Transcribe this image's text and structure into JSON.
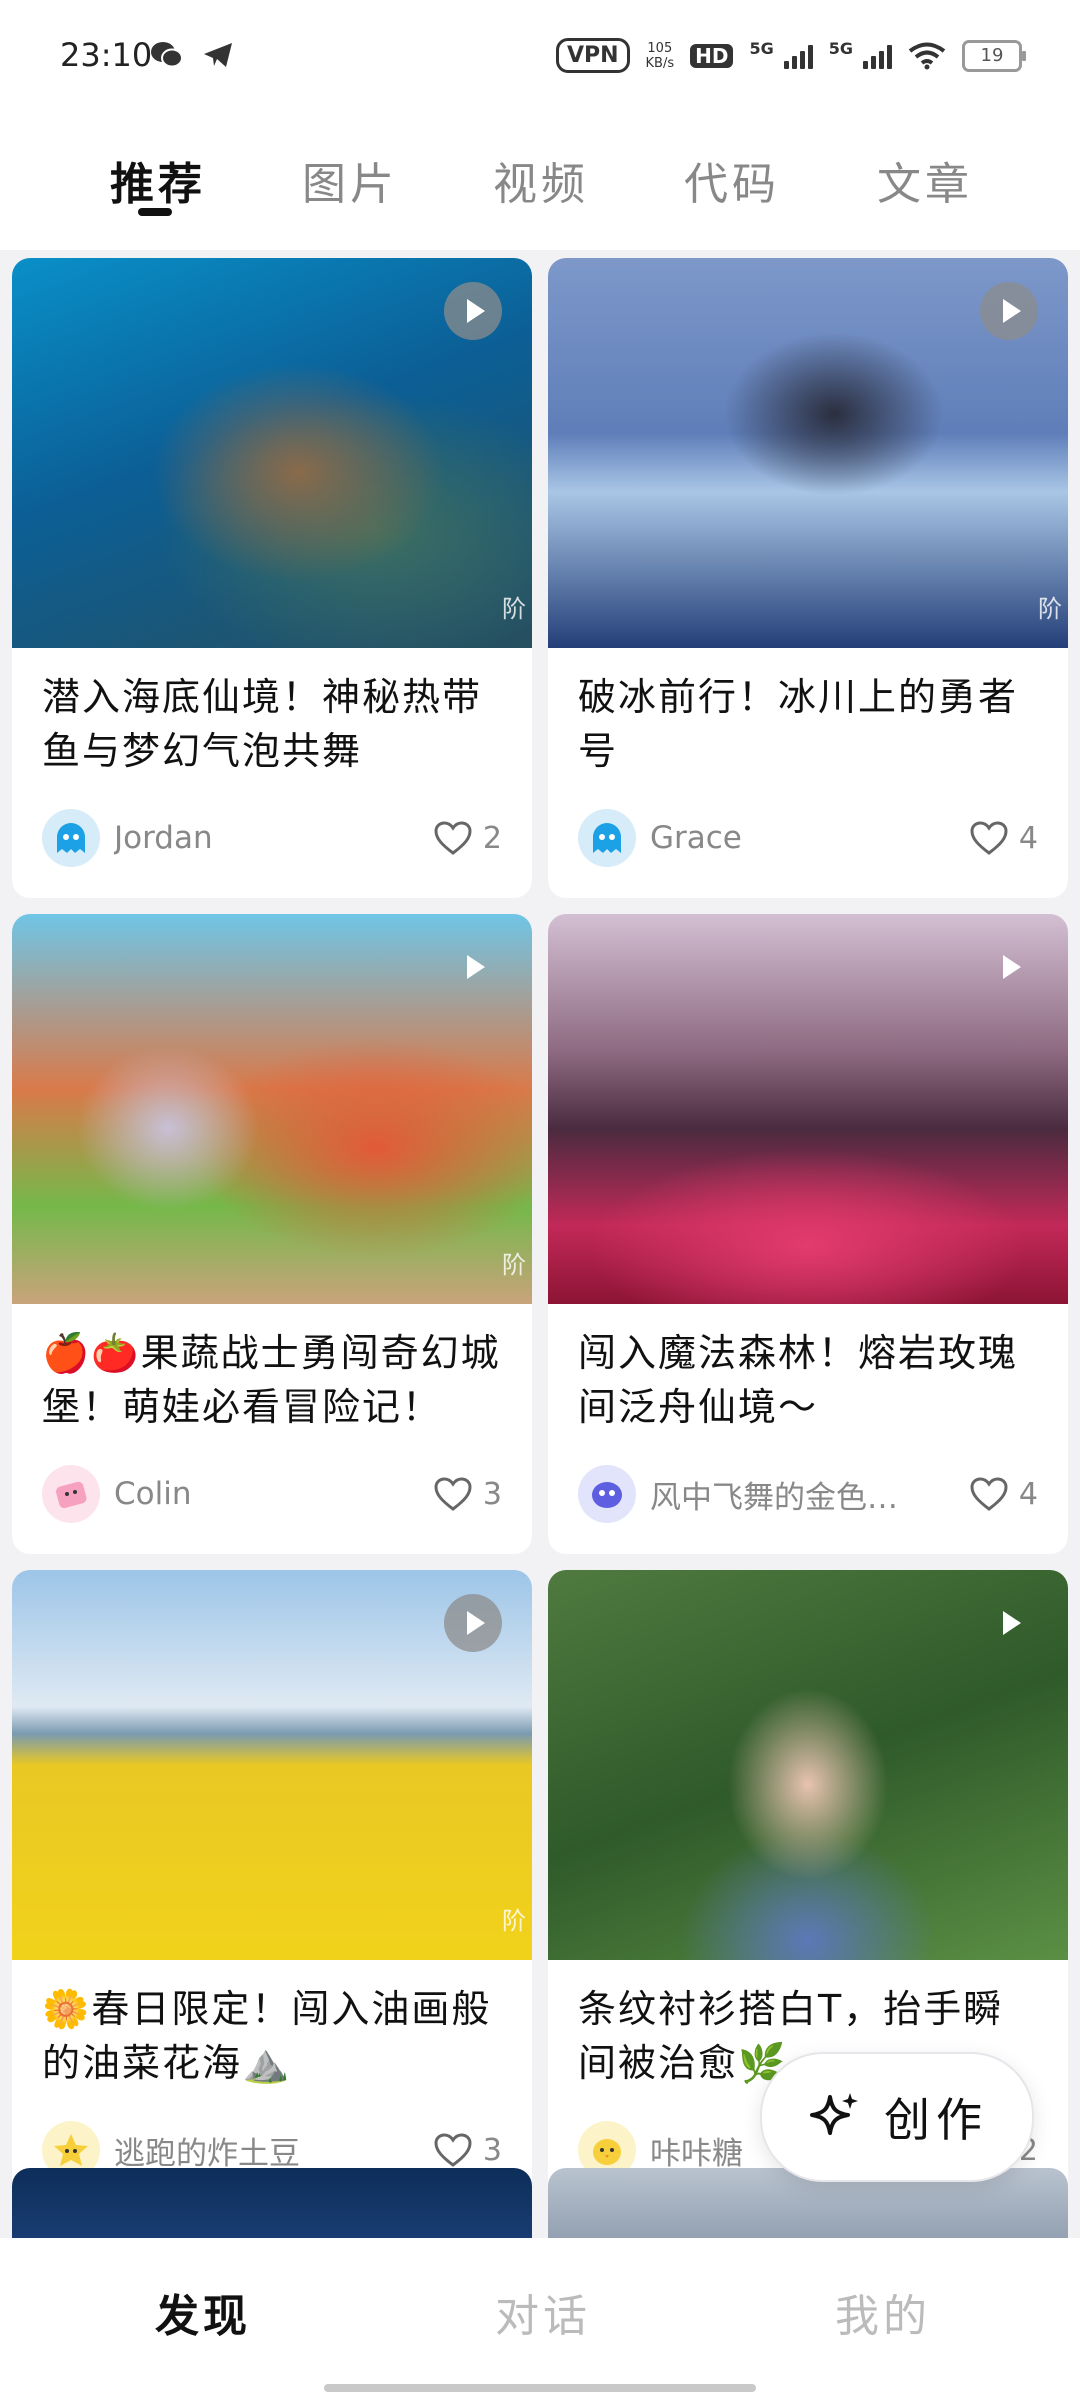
{
  "status_bar": {
    "time": "23:10",
    "vpn": "VPN",
    "net_speed_value": "105",
    "net_speed_unit": "KB/s",
    "hd": "HD",
    "sim1_label": "5G",
    "sim2_label": "5G",
    "battery": "19"
  },
  "tabs": [
    "推荐",
    "图片",
    "视频",
    "代码",
    "文章"
  ],
  "active_tab": "推荐",
  "cards": [
    {
      "title": "潜入海底仙境！神秘热带鱼与梦幻气泡共舞",
      "author": "Jordan",
      "likes": "2",
      "thumb_mark": "阶"
    },
    {
      "title": "破冰前行！冰川上的勇者号",
      "author": "Grace",
      "likes": "4",
      "thumb_mark": "阶"
    },
    {
      "title": "🍎🍅果蔬战士勇闯奇幻城堡！萌娃必看冒险记！",
      "author": "Colin",
      "likes": "3",
      "thumb_mark": "阶"
    },
    {
      "title": "闯入魔法森林！熔岩玫瑰间泛舟仙境～",
      "author": "风中飞舞的金色…",
      "likes": "4"
    },
    {
      "title": "🌼春日限定！闯入油画般的油菜花海⛰️",
      "author": "逃跑的炸土豆",
      "likes": "3",
      "thumb_mark": "阶"
    },
    {
      "title": "条纹衬衫搭白T，抬手瞬间被治愈🌿",
      "author": "咔咔糖",
      "likes": "2"
    }
  ],
  "create_button": {
    "label": "创作"
  },
  "bottom_nav": [
    "发现",
    "对话",
    "我的"
  ],
  "active_nav": "发现",
  "colors": {
    "accent": "#111111",
    "muted": "#888888",
    "background": "#f2f2f5"
  }
}
